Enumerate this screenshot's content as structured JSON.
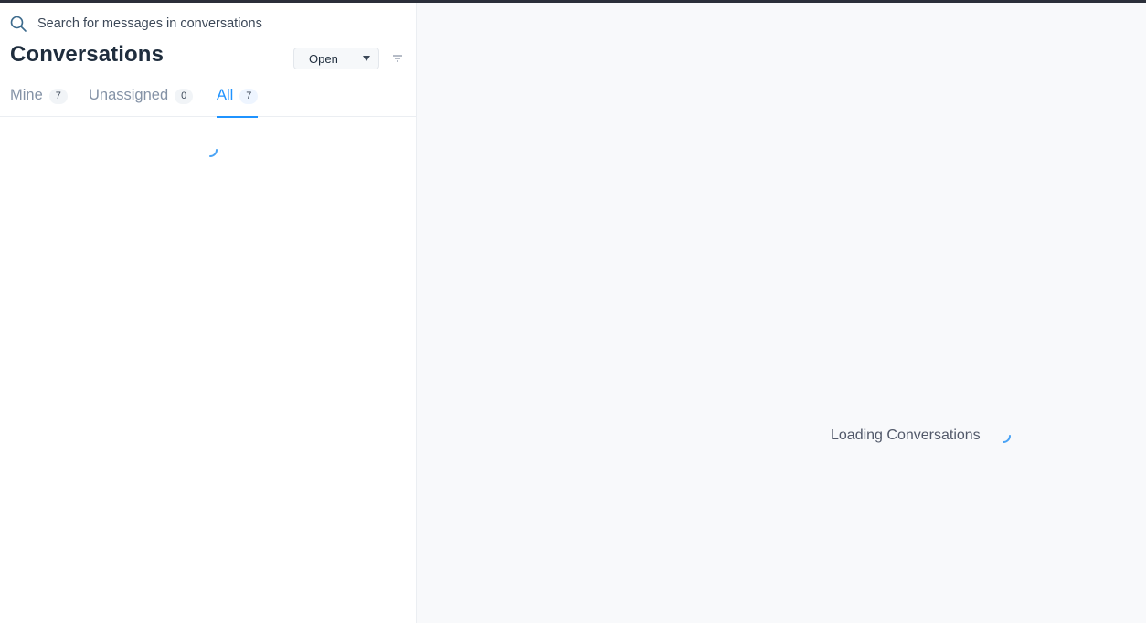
{
  "search": {
    "placeholder": "Search for messages in conversations",
    "icon": "search-icon"
  },
  "header": {
    "title": "Conversations"
  },
  "status_filter": {
    "selected": "Open"
  },
  "tabs": [
    {
      "label": "Mine",
      "count": "7",
      "active": false
    },
    {
      "label": "Unassigned",
      "count": "0",
      "active": false
    },
    {
      "label": "All",
      "count": "7",
      "active": true
    }
  ],
  "detail": {
    "loading_text": "Loading Conversations"
  },
  "colors": {
    "accent": "#1f93ff",
    "muted": "#8492a6",
    "background_detail": "#f8f9fb",
    "topbar": "#2b2f3a"
  }
}
